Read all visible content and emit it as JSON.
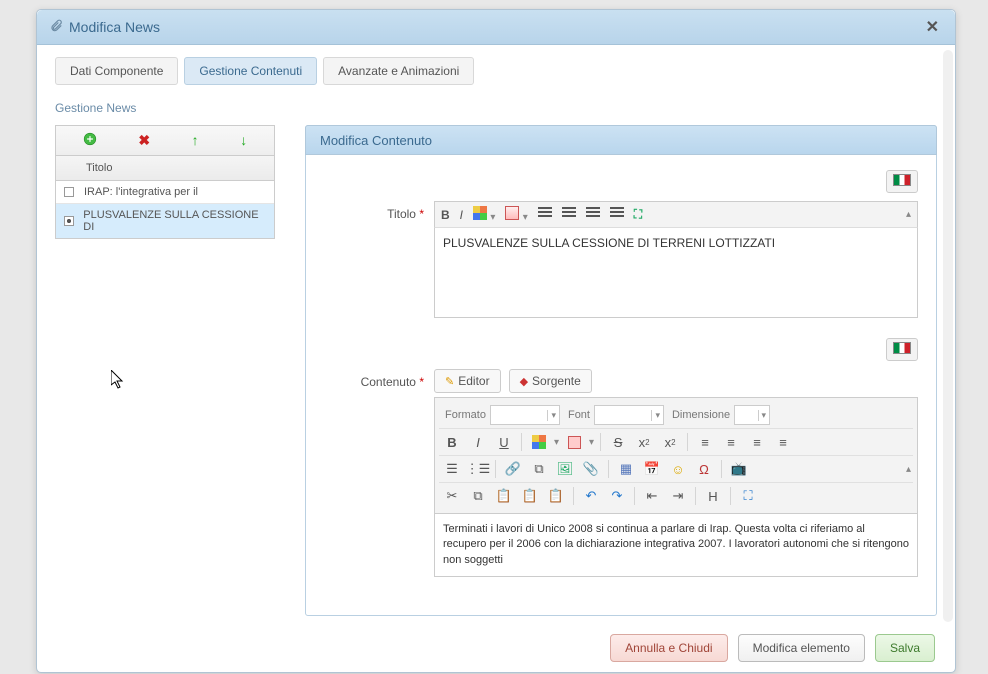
{
  "dialog": {
    "title": "Modifica News"
  },
  "tabs": {
    "t1": "Dati Componente",
    "t2": "Gestione Contenuti",
    "t3": "Avanzate e Animazioni"
  },
  "section": "Gestione News",
  "list": {
    "header": "Titolo",
    "rows": [
      "IRAP: l'integrativa per il",
      "PLUSVALENZE SULLA CESSIONE DI"
    ]
  },
  "fieldset": {
    "legend": "Modifica Contenuto"
  },
  "form": {
    "titolo_label": "Titolo",
    "titolo_value": "PLUSVALENZE SULLA CESSIONE DI TERRENI LOTTIZZATI",
    "contenuto_label": "Contenuto",
    "editor_tab": "Editor",
    "sorgente_tab": "Sorgente",
    "formato_lbl": "Formato",
    "font_lbl": "Font",
    "dimensione_lbl": "Dimensione",
    "contenuto_value": "Terminati i lavori di Unico 2008 si continua a parlare di Irap. Questa volta ci riferiamo al recupero per il 2006 con la dichiarazione integrativa 2007. I lavoratori autonomi che si ritengono non soggetti"
  },
  "footer": {
    "cancel": "Annulla e Chiudi",
    "modify": "Modifica elemento",
    "save": "Salva"
  }
}
